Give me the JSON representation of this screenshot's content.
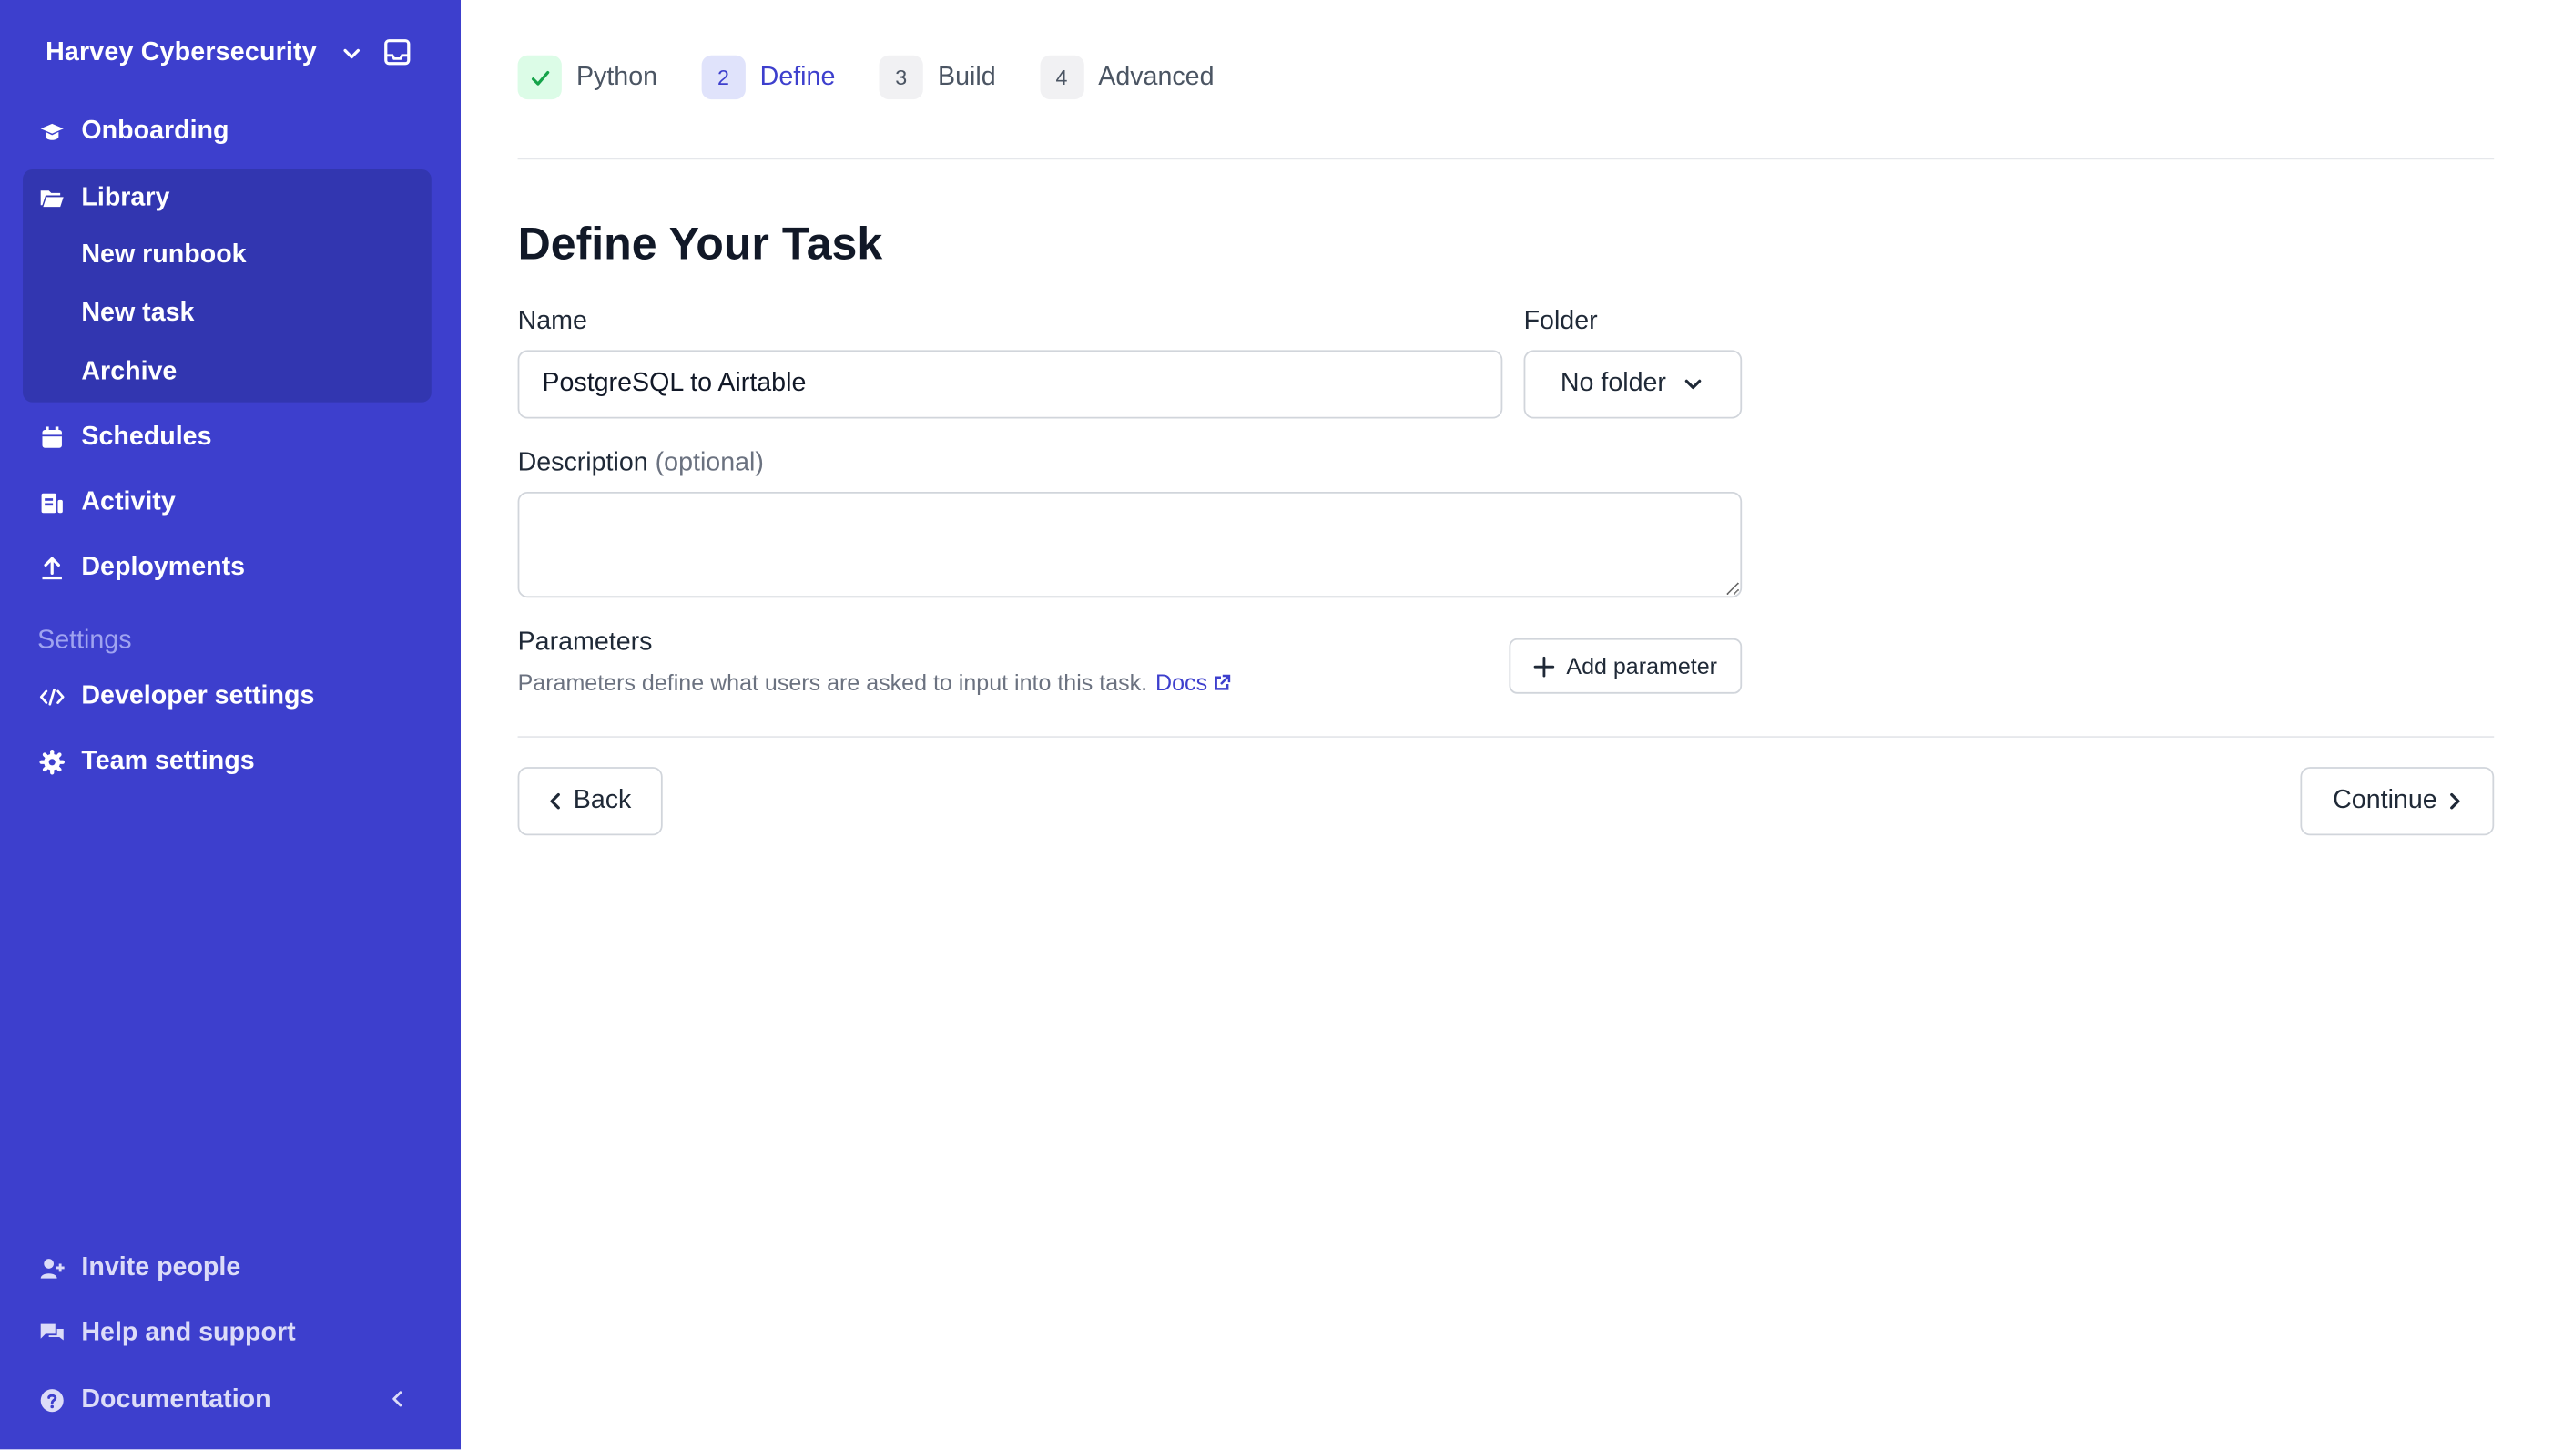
{
  "colors": {
    "sidebar_bg": "#3d3fcd",
    "sidebar_active_bg": "#3236b0",
    "accent": "#3d3fcd",
    "success_bg": "#dcfce7",
    "success_icon": "#16a34a"
  },
  "sidebar": {
    "workspace_name": "Harvey Cybersecurity",
    "items": {
      "onboarding": "Onboarding",
      "library": "Library",
      "new_runbook": "New runbook",
      "new_task": "New task",
      "archive": "Archive",
      "schedules": "Schedules",
      "activity": "Activity",
      "deployments": "Deployments"
    },
    "settings_label": "Settings",
    "settings_items": {
      "developer": "Developer settings",
      "team": "Team settings"
    },
    "bottom_items": {
      "invite": "Invite people",
      "help": "Help and support",
      "docs": "Documentation"
    }
  },
  "steps": [
    {
      "label": "Python",
      "state": "done",
      "icon": "check-icon"
    },
    {
      "number": "2",
      "label": "Define",
      "state": "active"
    },
    {
      "number": "3",
      "label": "Build",
      "state": "todo"
    },
    {
      "number": "4",
      "label": "Advanced",
      "state": "todo"
    }
  ],
  "form": {
    "title": "Define Your Task",
    "name_label": "Name",
    "name_value": "PostgreSQL to Airtable",
    "folder_label": "Folder",
    "folder_value": "No folder",
    "description_label": "Description",
    "description_optional": "(optional)",
    "description_value": "",
    "parameters_title": "Parameters",
    "parameters_desc": "Parameters define what users are asked to input into this task.",
    "docs_link": "Docs",
    "add_parameter": "Add parameter",
    "back": "Back",
    "continue": "Continue"
  }
}
